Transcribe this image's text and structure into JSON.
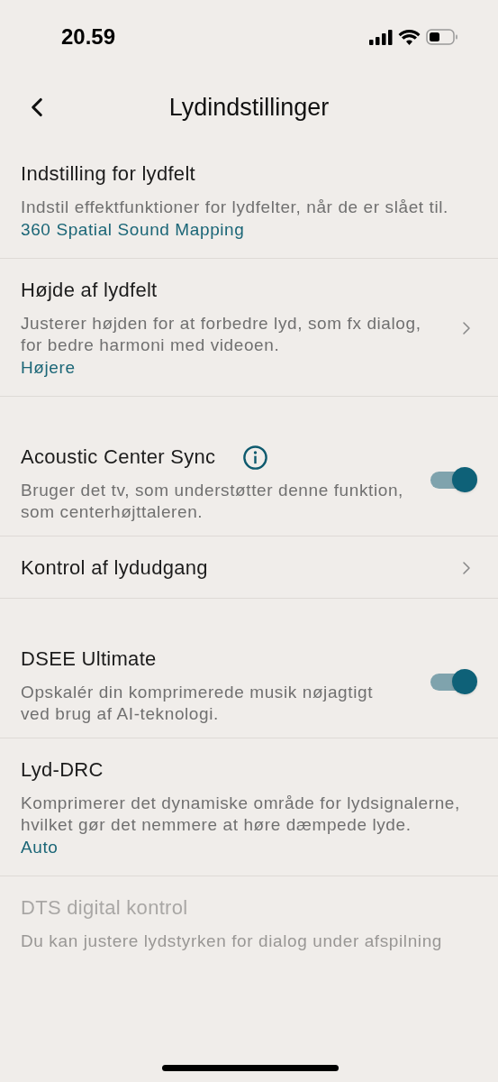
{
  "status_bar": {
    "time": "20.59"
  },
  "header": {
    "title": "Lydindstillinger"
  },
  "items": [
    {
      "kind": "plain",
      "title": "Indstilling for lydfelt",
      "description": "Indstil effektfunktioner for lydfelter, når de er slået til.",
      "value": "360 Spatial Sound Mapping",
      "disabled": false
    },
    {
      "kind": "nav",
      "title": "Højde af lydfelt",
      "description": "Justerer højden for at forbedre lyd, som fx dialog, for bedre harmoni med videoen.",
      "value": "Højere",
      "disabled": false
    },
    {
      "kind": "toggle",
      "title": "Acoustic Center Sync",
      "info": true,
      "description": "Bruger det tv, som understøtter denne funktion, som centerhøjttaleren.",
      "on": true,
      "disabled": false
    },
    {
      "kind": "nav",
      "title": "Kontrol af lydudgang",
      "disabled": false
    },
    {
      "kind": "toggle",
      "title": "DSEE Ultimate",
      "description": "Opskalér din komprimerede musik nøjagtigt ved brug af AI-teknologi.",
      "on": true,
      "disabled": false
    },
    {
      "kind": "plain",
      "title": "Lyd-DRC",
      "description": "Komprimerer det dynamiske område for lydsignalerne, hvilket gør det nemmere at høre dæmpede lyde.",
      "value": "Auto",
      "disabled": false
    },
    {
      "kind": "plain",
      "title": "DTS digital kontrol",
      "description": "Du kan justere lydstyrken for dialog under afspilning",
      "disabled": true
    }
  ]
}
